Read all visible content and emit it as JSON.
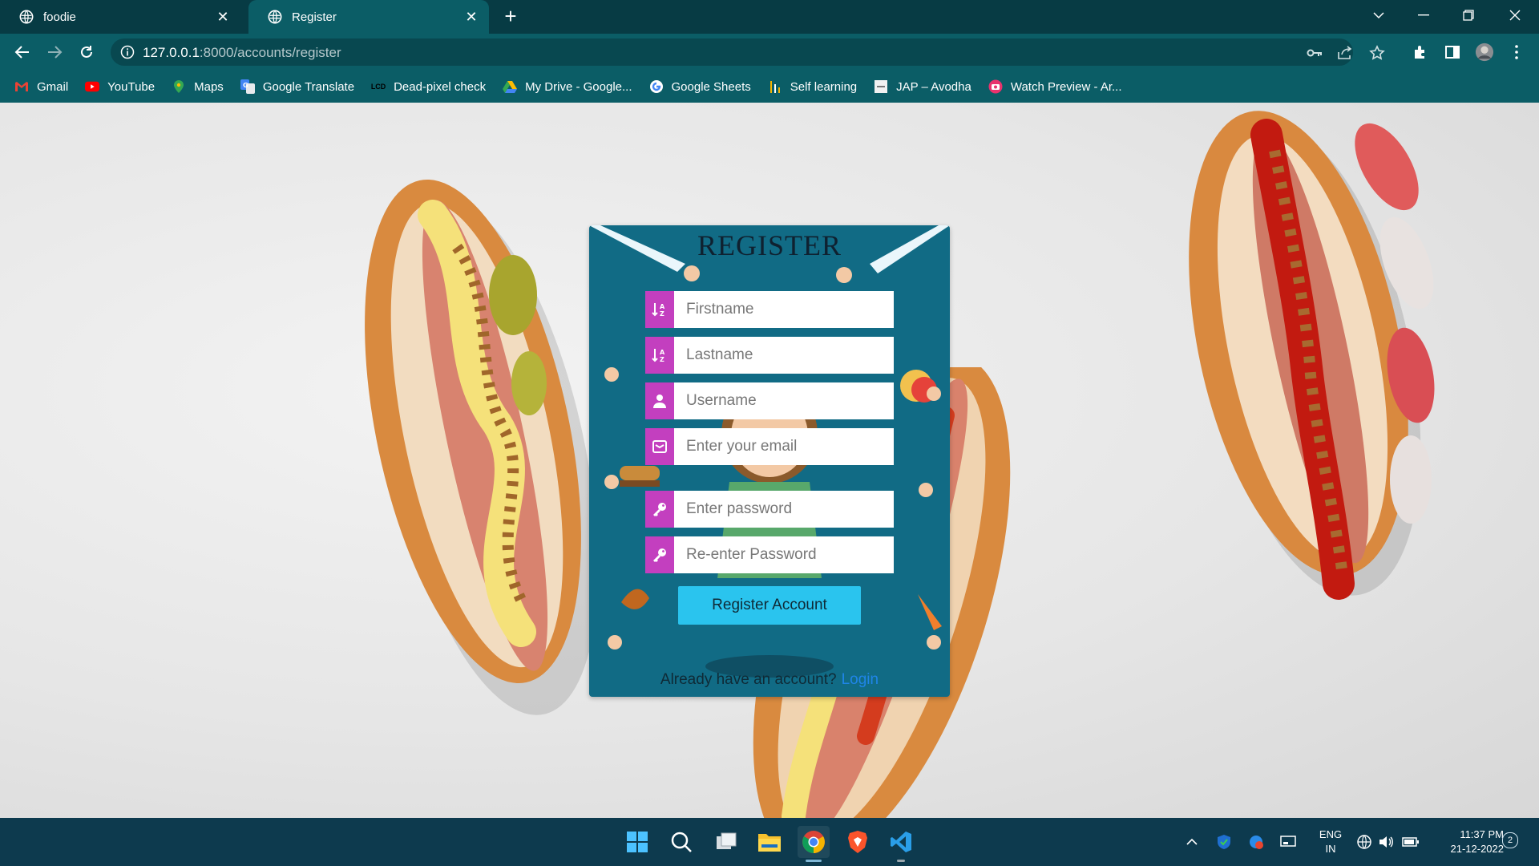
{
  "browser": {
    "tabs": [
      {
        "title": "foodie",
        "close": "✕"
      },
      {
        "title": "Register",
        "close": "✕"
      }
    ],
    "new_tab": "+",
    "url_host": "127.0.0.1",
    "url_path": ":8000/accounts/register",
    "bookmarks": [
      {
        "label": "Gmail",
        "icon": "gmail-icon"
      },
      {
        "label": "YouTube",
        "icon": "youtube-icon"
      },
      {
        "label": "Maps",
        "icon": "maps-icon"
      },
      {
        "label": "Google Translate",
        "icon": "translate-icon"
      },
      {
        "label": "Dead-pixel check",
        "icon": "lcd-icon",
        "icon_text": "LCD"
      },
      {
        "label": "My Drive - Google...",
        "icon": "drive-icon"
      },
      {
        "label": "Google Sheets",
        "icon": "google-icon"
      },
      {
        "label": "Self learning",
        "icon": "bars-icon"
      },
      {
        "label": "JAP – Avodha",
        "icon": "page-icon"
      },
      {
        "label": "Watch Preview - Ar...",
        "icon": "camera-icon"
      }
    ]
  },
  "form": {
    "title": "REGISTER",
    "firstname_placeholder": "Firstname",
    "lastname_placeholder": "Lastname",
    "username_placeholder": "Username",
    "email_placeholder": "Enter your email",
    "password_placeholder": "Enter password",
    "repassword_placeholder": "Re-enter Password",
    "submit_label": "Register Account",
    "login_prompt": "Already have an account?",
    "login_link": "Login"
  },
  "taskbar": {
    "lang_line1": "ENG",
    "lang_line2": "IN",
    "time": "11:37 PM",
    "date": "21-12-2022",
    "notifications": "2"
  },
  "colors": {
    "chrome_dark": "#073b44",
    "chrome_toolbar": "#0b5d66",
    "card_bg": "#116b85",
    "icon_box": "#c33fbf",
    "button": "#2ac4ee",
    "link": "#1f85e8",
    "taskbar": "#0d3a4e"
  }
}
